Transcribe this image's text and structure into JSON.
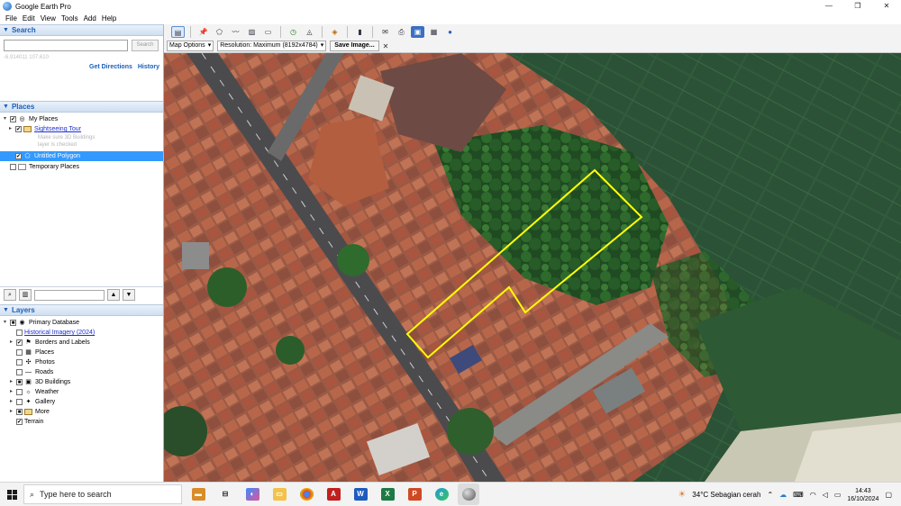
{
  "window": {
    "title": "Google Earth Pro",
    "minimize": "—",
    "maximize": "❐",
    "close": "✕"
  },
  "menu": [
    "File",
    "Edit",
    "View",
    "Tools",
    "Add",
    "Help"
  ],
  "search": {
    "header": "Search",
    "placeholder": "",
    "button": "Search",
    "coords": "-6.914011 107.610",
    "get_directions": "Get Directions",
    "history": "History"
  },
  "places": {
    "header": "Places",
    "my_places": "My Places",
    "sightseeing": "Sightseeing Tour",
    "sightseeing_sub1": "Make sure 3D Buildings",
    "sightseeing_sub2": "layer is checked",
    "untitled": "Untitled Polygon",
    "temporary": "Temporary Places"
  },
  "layers": {
    "header": "Layers",
    "items": [
      "Primary Database",
      "Historical Imagery (2024)",
      "Borders and Labels",
      "Places",
      "Photos",
      "Roads",
      "3D Buildings",
      "Weather",
      "Gallery",
      "More",
      "Terrain"
    ]
  },
  "toolbar": {
    "map_options": "Map Options",
    "resolution": "Resolution: Maximum (8192x4784)",
    "save_image": "Save Image...",
    "close": "✕"
  },
  "taskbar": {
    "search_placeholder": "Type here to search",
    "weather": "34°C  Sebagian cerah",
    "time": "14:43",
    "date": "16/10/2024"
  },
  "colors": {
    "accent": "#1b5fb8",
    "selection": "#3399ff",
    "polygon": "#ffff00",
    "rice_field": "#2f5a3a"
  }
}
